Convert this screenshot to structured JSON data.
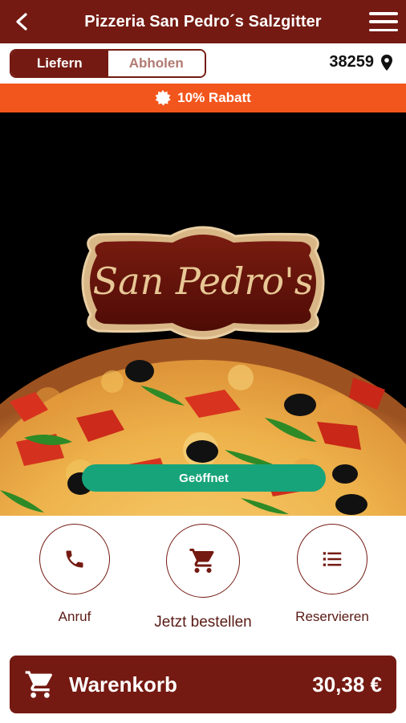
{
  "header": {
    "title": "Pizzeria San Pedro´s Salzgitter",
    "back_icon": "arrow-left-icon",
    "menu_icon": "hamburger-menu-icon"
  },
  "mode": {
    "options": [
      "Liefern",
      "Abholen"
    ],
    "selected": "Liefern",
    "zip": "38259",
    "zip_icon": "location-pin-icon"
  },
  "banner": {
    "text": "10% Rabatt",
    "icon": "discount-badge-icon",
    "color": "#f2561d"
  },
  "hero": {
    "logo_text": "San Pedro's",
    "status": "Geöffnet",
    "status_color": "#18a47a"
  },
  "actions": [
    {
      "label": "Anruf",
      "icon": "phone-icon"
    },
    {
      "label": "Jetzt bestellen",
      "icon": "shopping-cart-icon"
    },
    {
      "label": "Reservieren",
      "icon": "list-icon"
    }
  ],
  "cart": {
    "label": "Warenkorb",
    "total": "30,38 €",
    "icon": "shopping-cart-icon"
  },
  "colors": {
    "brand": "#741a12",
    "accent": "#f2561d"
  }
}
